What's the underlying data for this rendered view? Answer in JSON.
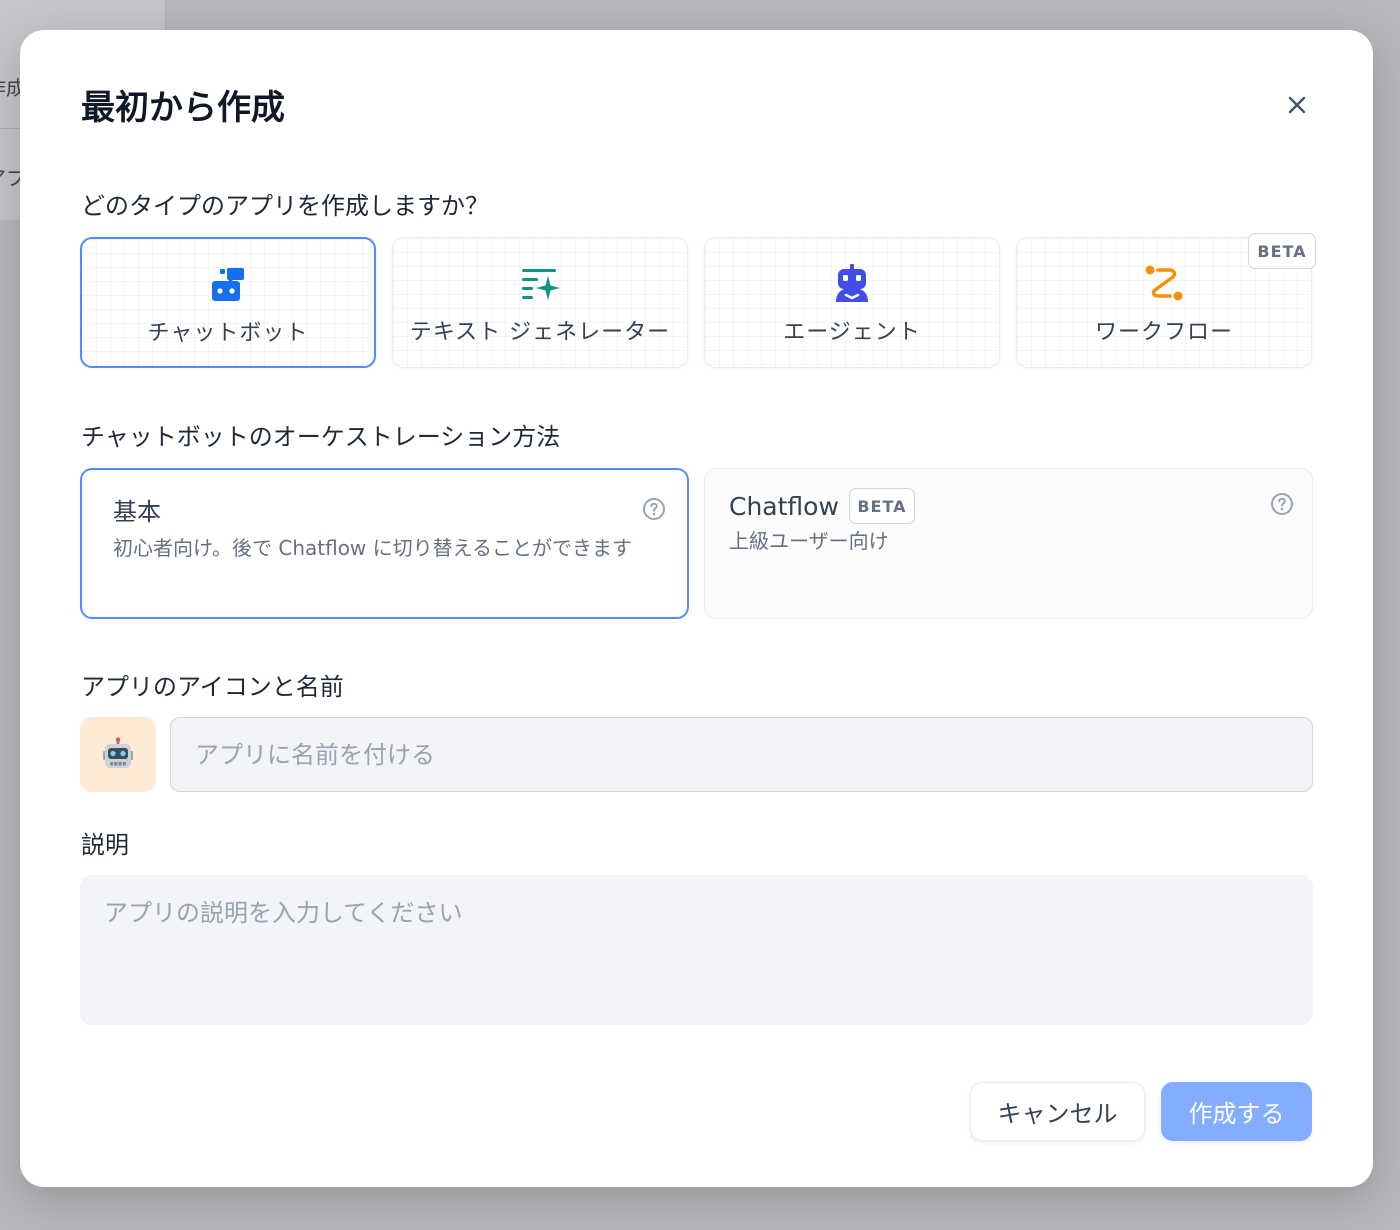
{
  "background": {
    "fragment_top": "作成",
    "fragment_bottom": "アプ"
  },
  "dialog": {
    "title": "最初から作成",
    "close_icon": "close-icon"
  },
  "app_type": {
    "label": "どのタイプのアプリを作成しますか？",
    "cards": [
      {
        "id": "chatbot",
        "label": "チャットボット",
        "icon": "chatbot-icon",
        "color": "#1570ef",
        "selected": true
      },
      {
        "id": "text-generator",
        "label": "テキスト ジェネレーター",
        "icon": "text-generator-icon",
        "color": "#0e9384",
        "selected": false
      },
      {
        "id": "agent",
        "label": "エージェント",
        "icon": "agent-robot-icon",
        "color": "#444ce7",
        "selected": false
      },
      {
        "id": "workflow",
        "label": "ワークフロー",
        "icon": "workflow-icon",
        "color": "#f79009",
        "selected": false,
        "badge": "BETA"
      }
    ]
  },
  "orchestration": {
    "label": "チャットボットのオーケストレーション方法",
    "options": [
      {
        "id": "basic",
        "title": "基本",
        "description": "初心者向け。後で Chatflow に切り替えることができます",
        "selected": true
      },
      {
        "id": "chatflow",
        "title": "Chatflow",
        "badge": "BETA",
        "description": "上級ユーザー向け",
        "selected": false
      }
    ]
  },
  "app_icon_name": {
    "label": "アプリのアイコンと名前",
    "icon": "robot-emoji-icon",
    "icon_bg": "#ffead5",
    "name_placeholder": "アプリに名前を付ける",
    "name_value": ""
  },
  "description": {
    "label": "説明",
    "placeholder": "アプリの説明を入力してください",
    "value": ""
  },
  "footer": {
    "cancel_label": "キャンセル",
    "create_label": "作成する"
  },
  "colors": {
    "accent": "#528bff",
    "primary_button_disabled": "#84adff"
  }
}
